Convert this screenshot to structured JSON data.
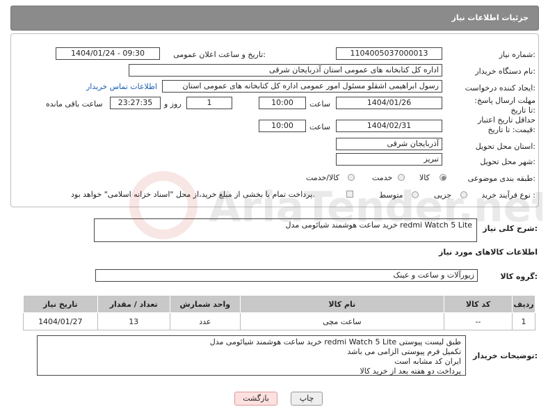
{
  "header": {
    "title": "جزئیات اطلاعات نیاز"
  },
  "form": {
    "need_number_label": "شماره نیاز:",
    "need_number": "1104005037000013",
    "announce_label": "تاریخ و ساعت اعلان عمومی:",
    "announce_value": "1404/01/24 - 09:30",
    "buyer_org_label": "نام دستگاه خریدار:",
    "buyer_org": "اداره کل کتابخانه های عمومی استان آذربایجان شرقی",
    "creator_label": "ایجاد کننده درخواست:",
    "creator": "رسول ابراهیمی اشقلو مسئول امور عمومی اداره کل کتابخانه های عمومی استان",
    "contact_link": "اطلاعات تماس خریدار",
    "reply_deadline_label": "مهلت ارسال پاسخ: تا تاریخ:",
    "reply_date": "1404/01/26",
    "time_label": "ساعت",
    "reply_time": "10:00",
    "days_value": "1",
    "days_label": "روز و",
    "remaining_time": "23:27:35",
    "remaining_label": "ساعت باقی مانده",
    "price_deadline_label": "حداقل تاریخ اعتبار قیمت: تا تاریخ:",
    "price_date": "1404/02/31",
    "price_time": "10:00",
    "province_label": "استان محل تحویل:",
    "province": "آذربایجان شرقی",
    "city_label": "شهر محل تحویل:",
    "city": "تبریز",
    "category_label": "طبقه بندی موضوعی:",
    "category_options": [
      "کالا",
      "خدمت",
      "کالا/خدمت"
    ],
    "process_label": "نوع فرآیند خرید :",
    "process_options": [
      "جزیی",
      "متوسط"
    ],
    "payment_note": "پرداخت تمام یا بخشی از مبلغ خرید،از محل \"اسناد خزانه اسلامی\" خواهد بود."
  },
  "description": {
    "label": "شرح کلی نیاز:",
    "value": "خرید ساعت هوشمند شیائومی مدل redmi Watch 5 Lite"
  },
  "goods": {
    "section_title": "اطلاعات کالاهای مورد نیاز",
    "group_label": "گروه کالا:",
    "group_value": "زیورآلات و ساعت و عینک",
    "columns": [
      "ردیف",
      "کد کالا",
      "نام کالا",
      "واحد شمارش",
      "تعداد / مقدار",
      "تاریخ نیاز"
    ],
    "rows": [
      {
        "row": "1",
        "code": "--",
        "name": "ساعت مچی",
        "unit": "عدد",
        "qty": "13",
        "date": "1404/01/27"
      }
    ]
  },
  "buyer_notes": {
    "label": "توضیحات خریدار:",
    "lines": [
      "خرید ساعت هوشمند شیائومی مدل redmi Watch 5 Lite طبق لیست پیوستی",
      "تکمیل فرم پیوستی الزامی می باشد",
      "ایران کد مشابه است",
      "پرداخت دو هفته بعد از خرید کالا"
    ]
  },
  "buttons": {
    "print": "چاپ",
    "back": "بازگشت"
  },
  "watermark": {
    "text": "AriaTender.net"
  }
}
